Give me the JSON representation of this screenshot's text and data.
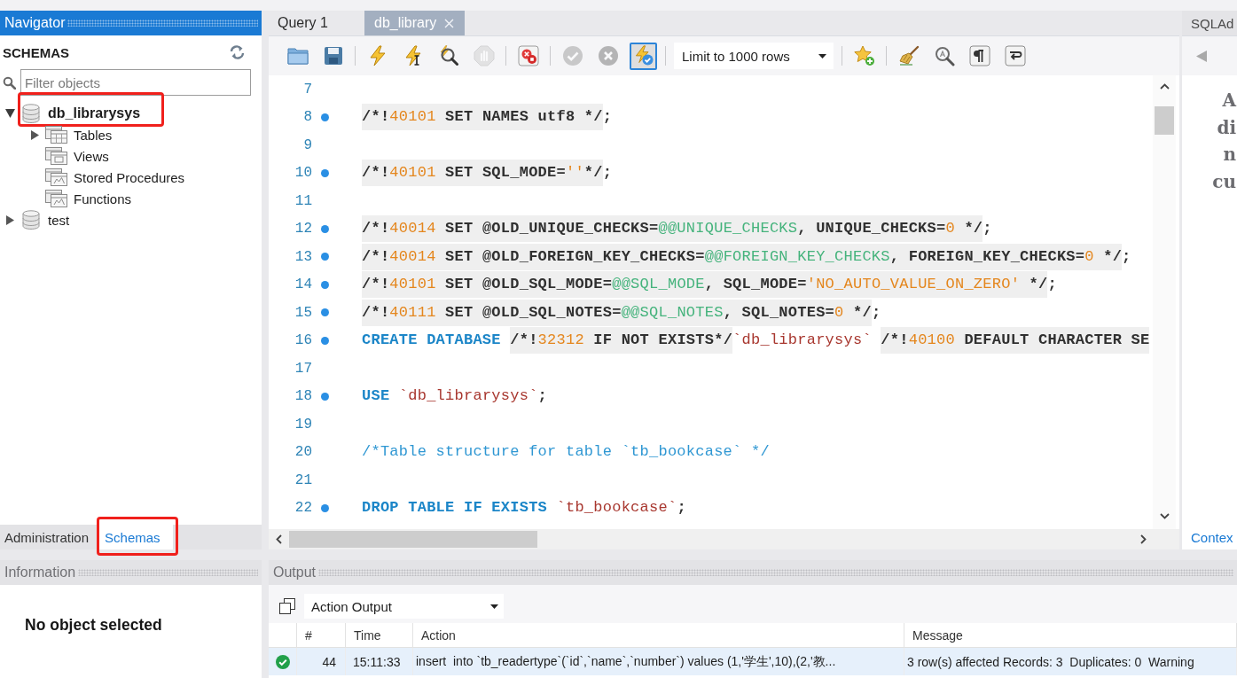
{
  "navigator": {
    "title": "Navigator",
    "focused": true,
    "heading": "SCHEMAS",
    "filter": {
      "placeholder": "Filter objects"
    },
    "schemas": [
      {
        "name": "db_librarysys",
        "default": true,
        "expanded": true,
        "marked": true,
        "children": [
          {
            "name": "Tables",
            "kind": "tables",
            "expandable": true,
            "expanded": false
          },
          {
            "name": "Views",
            "kind": "views",
            "expandable": false,
            "expanded": false
          },
          {
            "name": "Stored Procedures",
            "kind": "routines",
            "expandable": false,
            "expanded": false
          },
          {
            "name": "Functions",
            "kind": "routines",
            "expandable": false,
            "expanded": false
          }
        ]
      },
      {
        "name": "test",
        "default": false,
        "expanded": false,
        "marked": false
      }
    ],
    "tabs": [
      {
        "label": "Administration",
        "selected": false,
        "marked": false
      },
      {
        "label": "Schemas",
        "selected": true,
        "marked": true
      }
    ]
  },
  "editor_tabs": [
    {
      "label": "Query 1",
      "selected": false,
      "closable": false
    },
    {
      "label": "db_library",
      "selected": true,
      "closable": true
    }
  ],
  "toolbar": {
    "groups": [
      [
        {
          "kind": "open",
          "disabled": false,
          "on": false
        },
        {
          "kind": "save",
          "disabled": false,
          "on": false
        }
      ],
      [
        {
          "kind": "execute",
          "disabled": false,
          "on": false
        },
        {
          "kind": "current",
          "disabled": false,
          "on": false
        },
        {
          "kind": "explain",
          "disabled": false,
          "on": false
        },
        {
          "kind": "stop",
          "disabled": true,
          "on": false
        }
      ],
      [
        {
          "kind": "halt",
          "disabled": false,
          "on": false
        }
      ],
      [
        {
          "kind": "commit",
          "disabled": true,
          "on": false
        },
        {
          "kind": "rollback",
          "disabled": true,
          "on": false
        },
        {
          "kind": "autocommit",
          "disabled": false,
          "on": true
        }
      ],
      [
        {
          "kind": "limit",
          "value": "Limit to 1000 rows",
          "disabled": false,
          "on": false
        }
      ],
      [
        {
          "kind": "snippet",
          "disabled": false,
          "on": false
        }
      ],
      [
        {
          "kind": "beautify",
          "disabled": false,
          "on": false
        },
        {
          "kind": "find",
          "disabled": false,
          "on": false
        },
        {
          "kind": "invisibles",
          "disabled": false,
          "on": false
        },
        {
          "kind": "wrap",
          "disabled": false,
          "on": false
        }
      ]
    ]
  },
  "editor": {
    "lines": [
      {
        "number": "7",
        "marker": false
      },
      {
        "number": "8",
        "marker": true,
        "spans": [
          {
            "shaded": true,
            "tokens": [
              {
                "kind": "plain",
                "text": "/*!"
              },
              {
                "kind": "number",
                "text": "40101"
              },
              {
                "kind": "plain",
                "text": " SET NAMES utf8 */"
              }
            ]
          },
          {
            "shaded": false,
            "tokens": [
              {
                "kind": "plain",
                "text": ";"
              }
            ]
          }
        ]
      },
      {
        "number": "9",
        "marker": false
      },
      {
        "number": "10",
        "marker": true,
        "spans": [
          {
            "shaded": true,
            "tokens": [
              {
                "kind": "plain",
                "text": "/*!"
              },
              {
                "kind": "number",
                "text": "40101"
              },
              {
                "kind": "plain",
                "text": " SET SQL_MODE="
              },
              {
                "kind": "string",
                "text": "''"
              },
              {
                "kind": "plain",
                "text": "*/"
              }
            ]
          },
          {
            "shaded": false,
            "tokens": [
              {
                "kind": "plain",
                "text": ";"
              }
            ]
          }
        ]
      },
      {
        "number": "11",
        "marker": false
      },
      {
        "number": "12",
        "marker": true,
        "spans": [
          {
            "shaded": true,
            "tokens": [
              {
                "kind": "plain",
                "text": "/*!"
              },
              {
                "kind": "number",
                "text": "40014"
              },
              {
                "kind": "plain",
                "text": " SET @OLD_UNIQUE_CHECKS="
              },
              {
                "kind": "variable",
                "text": "@@UNIQUE_CHECKS"
              },
              {
                "kind": "plain",
                "text": ", UNIQUE_CHECKS="
              },
              {
                "kind": "number",
                "text": "0"
              },
              {
                "kind": "plain",
                "text": " */"
              }
            ]
          },
          {
            "shaded": false,
            "tokens": [
              {
                "kind": "plain",
                "text": ";"
              }
            ]
          }
        ]
      },
      {
        "number": "13",
        "marker": true,
        "spans": [
          {
            "shaded": true,
            "tokens": [
              {
                "kind": "plain",
                "text": "/*!"
              },
              {
                "kind": "number",
                "text": "40014"
              },
              {
                "kind": "plain",
                "text": " SET @OLD_FOREIGN_KEY_CHECKS="
              },
              {
                "kind": "variable",
                "text": "@@FOREIGN_KEY_CHECKS"
              },
              {
                "kind": "plain",
                "text": ", FOREIGN_KEY_CHECKS="
              },
              {
                "kind": "number",
                "text": "0"
              },
              {
                "kind": "plain",
                "text": " */"
              }
            ]
          },
          {
            "shaded": false,
            "tokens": [
              {
                "kind": "plain",
                "text": ";"
              }
            ]
          }
        ]
      },
      {
        "number": "14",
        "marker": true,
        "spans": [
          {
            "shaded": true,
            "tokens": [
              {
                "kind": "plain",
                "text": "/*!"
              },
              {
                "kind": "number",
                "text": "40101"
              },
              {
                "kind": "plain",
                "text": " SET @OLD_SQL_MODE="
              },
              {
                "kind": "variable",
                "text": "@@SQL_MODE"
              },
              {
                "kind": "plain",
                "text": ", SQL_MODE="
              },
              {
                "kind": "string",
                "text": "'NO_AUTO_VALUE_ON_ZERO'"
              },
              {
                "kind": "plain",
                "text": " */"
              }
            ]
          },
          {
            "shaded": false,
            "tokens": [
              {
                "kind": "plain",
                "text": ";"
              }
            ]
          }
        ]
      },
      {
        "number": "15",
        "marker": true,
        "spans": [
          {
            "shaded": true,
            "tokens": [
              {
                "kind": "plain",
                "text": "/*!"
              },
              {
                "kind": "number",
                "text": "40111"
              },
              {
                "kind": "plain",
                "text": " SET @OLD_SQL_NOTES="
              },
              {
                "kind": "variable",
                "text": "@@SQL_NOTES"
              },
              {
                "kind": "plain",
                "text": ", SQL_NOTES="
              },
              {
                "kind": "number",
                "text": "0"
              },
              {
                "kind": "plain",
                "text": " */"
              }
            ]
          },
          {
            "shaded": false,
            "tokens": [
              {
                "kind": "plain",
                "text": ";"
              }
            ]
          }
        ]
      },
      {
        "number": "16",
        "marker": true,
        "spans": [
          {
            "shaded": false,
            "tokens": [
              {
                "kind": "keyword",
                "text": "CREATE DATABASE "
              }
            ]
          },
          {
            "shaded": true,
            "tokens": [
              {
                "kind": "plain",
                "text": "/*!"
              },
              {
                "kind": "number",
                "text": "32312"
              },
              {
                "kind": "plain",
                "text": " IF NOT EXISTS*/"
              }
            ]
          },
          {
            "shaded": false,
            "tokens": [
              {
                "kind": "identifier",
                "text": "`db_librarysys` "
              }
            ]
          },
          {
            "shaded": true,
            "tokens": [
              {
                "kind": "plain",
                "text": "/*!"
              },
              {
                "kind": "number",
                "text": "40100"
              },
              {
                "kind": "plain",
                "text": " DEFAULT CHARACTER SE"
              }
            ]
          }
        ]
      },
      {
        "number": "17",
        "marker": false
      },
      {
        "number": "18",
        "marker": true,
        "spans": [
          {
            "shaded": false,
            "tokens": [
              {
                "kind": "keyword",
                "text": "USE "
              },
              {
                "kind": "identifier",
                "text": "`db_librarysys`"
              },
              {
                "kind": "plain",
                "text": ";"
              }
            ]
          }
        ]
      },
      {
        "number": "19",
        "marker": false
      },
      {
        "number": "20",
        "marker": false,
        "spans": [
          {
            "shaded": false,
            "tokens": [
              {
                "kind": "comment",
                "text": "/*Table structure for table `tb_bookcase` */"
              }
            ]
          }
        ]
      },
      {
        "number": "21",
        "marker": false
      },
      {
        "number": "22",
        "marker": true,
        "spans": [
          {
            "shaded": false,
            "tokens": [
              {
                "kind": "keyword",
                "text": "DROP TABLE IF EXISTS "
              },
              {
                "kind": "identifier",
                "text": "`tb_bookcase`"
              },
              {
                "kind": "plain",
                "text": ";"
              }
            ]
          }
        ]
      }
    ]
  },
  "side_panel": {
    "title": "SQLAd",
    "help_lines": [
      "A",
      "di",
      "n",
      "cu"
    ],
    "tabs": [
      {
        "label": "Contex",
        "selected": true
      }
    ]
  },
  "information": {
    "title": "Information",
    "focused": false,
    "message": "No object selected"
  },
  "output": {
    "title": "Output",
    "focused": false,
    "mode": {
      "value": "Action Output"
    },
    "columns": [
      "#",
      "Time",
      "Action",
      "Message"
    ],
    "rows": [
      {
        "kind": "success",
        "selected": true,
        "cells": [
          "44",
          "15:11:33",
          "insert  into `tb_readertype`(`id`,`name`,`number`) values (1,'学生',10),(2,'教...",
          "3 row(s) affected Records: 3  Duplicates: 0  Warning"
        ]
      }
    ]
  }
}
